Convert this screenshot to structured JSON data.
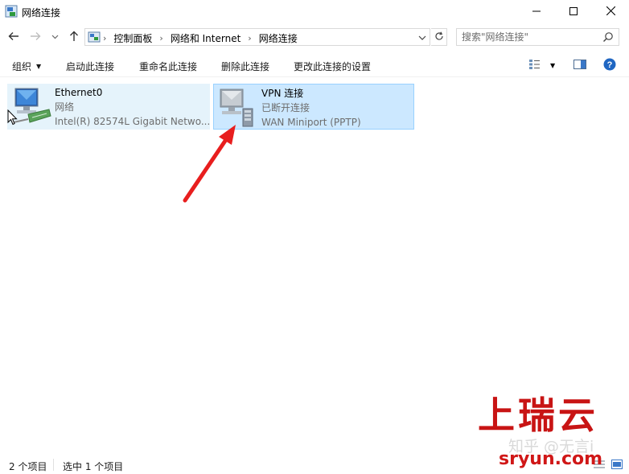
{
  "window": {
    "title": "网络连接",
    "controls": {
      "minimize_icon": "minimize-icon",
      "maximize_icon": "maximize-icon",
      "close_icon": "close-icon"
    }
  },
  "address_bar": {
    "breadcrumbs": [
      "控制面板",
      "网络和 Internet",
      "网络连接"
    ],
    "search_placeholder": "搜索\"网络连接\""
  },
  "command_bar": {
    "organize": "组织",
    "buttons": [
      "启动此连接",
      "重命名此连接",
      "删除此连接",
      "更改此连接的设置"
    ]
  },
  "connections": [
    {
      "name": "Ethernet0",
      "status": "网络",
      "device": "Intel(R) 82574L Gigabit Netwo...",
      "selected": false,
      "hovered": true
    },
    {
      "name": "VPN 连接",
      "status": "已断开连接",
      "device": "WAN Miniport (PPTP)",
      "selected": true,
      "hovered": false
    }
  ],
  "status_bar": {
    "item_count": "2 个项目",
    "selected_count": "选中 1 个项目"
  },
  "watermark": {
    "logo": "上瑞云",
    "zhihu": "知乎 @无言i",
    "url": "sryun.com"
  },
  "colors": {
    "selected_bg": "#cce8ff",
    "selected_border": "#99d1ff",
    "hover_bg": "#e5f3fb",
    "annotation_arrow": "#e81e1e",
    "watermark_red": "#c81414"
  }
}
